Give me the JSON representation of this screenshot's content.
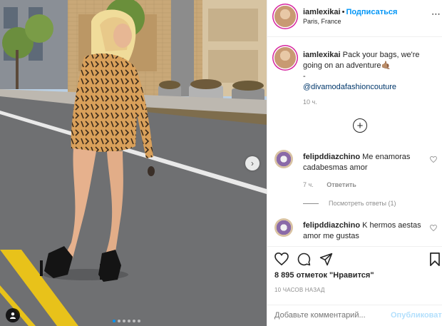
{
  "header": {
    "username": "iamlexikai",
    "separator": "•",
    "follow_label": "Подписаться",
    "location": "Paris, France",
    "more_icon": "more-icon"
  },
  "caption": {
    "username": "iamlexikai",
    "text": "Pack your bags, we're going on an adventure🤙🏽",
    "dash": "-",
    "mention": "@divamodafashioncouture",
    "time": "10 ч."
  },
  "load_more_icon": "plus-circle-icon",
  "comments": [
    {
      "username": "felipddiazchino",
      "text": "Me enamoras cadabesmas amor",
      "time": "7 ч.",
      "reply_label": "Ответить",
      "view_replies": "Посмотреть ответы (1)"
    },
    {
      "username": "felipddiazchino",
      "text": "K hermos aestas amor me gustas"
    }
  ],
  "actions": {
    "likes": "8 895 отметок \"Нравится\"",
    "posted_ago": "10 ЧАСОВ НАЗАД",
    "comment_placeholder": "Добавьте комментарий...",
    "post_label": "Опубликовать"
  },
  "media": {
    "carousel_dots": 6,
    "active_dot": 0
  },
  "colors": {
    "accent": "#0095f6",
    "post_disabled": "#b2dffc",
    "muted": "#8e8e8e",
    "text": "#262626"
  }
}
